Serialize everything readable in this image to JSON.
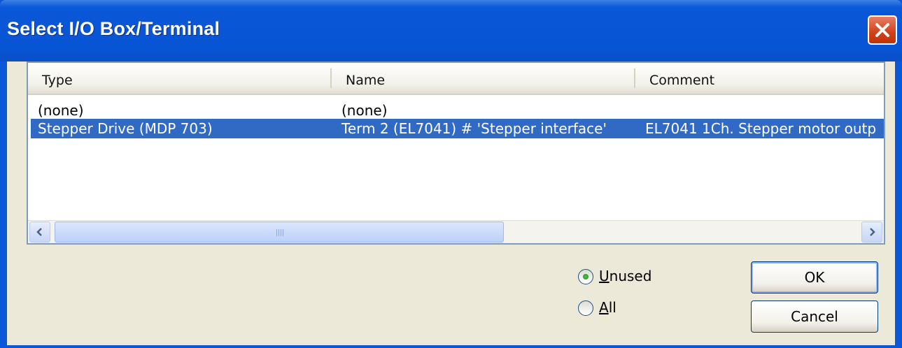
{
  "dialog": {
    "title": "Select I/O Box/Terminal"
  },
  "list": {
    "columns": [
      "Type",
      "Name",
      "Comment"
    ],
    "rows": [
      {
        "type": "(none)",
        "name": "(none)",
        "comment": "",
        "selected": false
      },
      {
        "type": "Stepper Drive (MDP 703)",
        "name": "Term 2 (EL7041) # 'Stepper interface'",
        "comment": "EL7041 1Ch. Stepper motor outp",
        "selected": true
      }
    ],
    "scroll_position": 0
  },
  "filter": {
    "options": [
      {
        "prefix": "",
        "accel": "U",
        "rest": "nused",
        "checked": true
      },
      {
        "prefix": "",
        "accel": "A",
        "rest": "ll",
        "checked": false
      }
    ]
  },
  "buttons": {
    "ok": "OK",
    "cancel": "Cancel"
  },
  "colors": {
    "title_bar": "#0a57d8",
    "selection": "#316ac5",
    "dialog_bg": "#ece9d8"
  }
}
